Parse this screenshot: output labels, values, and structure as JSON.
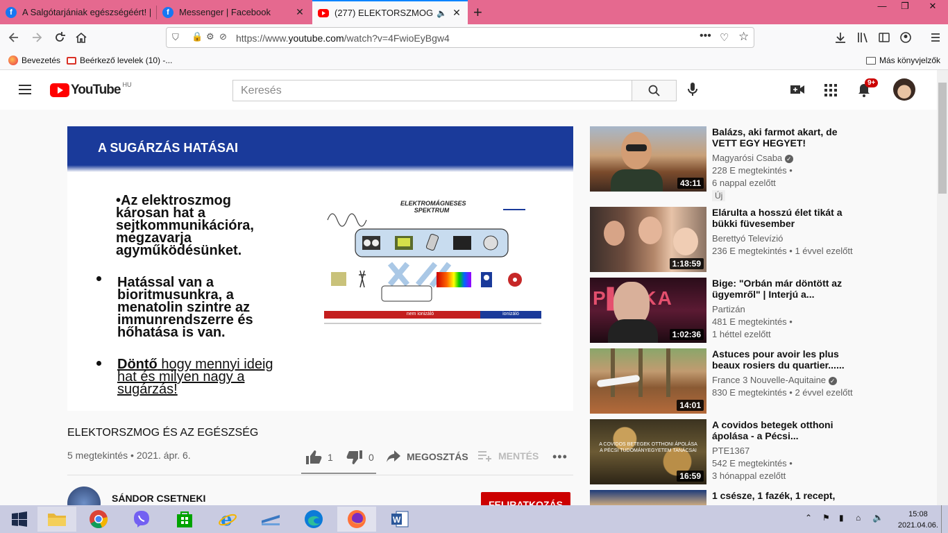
{
  "browser": {
    "tabs": [
      {
        "label": "A Salgótarjániak egészségéért! |",
        "active": false
      },
      {
        "label": "Messenger | Facebook",
        "active": false
      },
      {
        "label": "(277) ELEKTORSZMOG ÉS A",
        "active": true
      }
    ],
    "new_tab": "+",
    "url_prefix": "https://www.",
    "url_domain": "youtube.com",
    "url_rest": "/watch?v=4FwioEyBgw4",
    "bookmarks": [
      {
        "label": "Bevezetés"
      },
      {
        "label": "Beérkező levelek (10) -..."
      }
    ],
    "other_bookmarks": "Más könyvjelzők"
  },
  "youtube": {
    "logo_text": "YouTube",
    "country": "HU",
    "search_placeholder": "Keresés",
    "notifications": "9+",
    "slide": {
      "title": "A SUGÁRZÁS HATÁSAI",
      "bullet1": "•Az elektroszmog károsan hat a sejtkommunikációra, megzavarja agyműködésünket.",
      "bullet2": "Hatással van a bioritmusunkra, a menatolin szintre az immunrendszerre és hőhatása is van.",
      "bullet3_bold": "Döntő",
      "bullet3_rest": " hogy mennyi ideig hat és milyen nagy a sugárzás!",
      "spectrum_title": "ELEKTROMÁGNESES SPEKTRUM",
      "nonionizing": "nem ionizáló",
      "ionizing": "ionizáló"
    },
    "video": {
      "title": "ELEKTORSZMOG ÉS AZ EGÉSZSÉG",
      "meta": "5 megtekintés • 2021. ápr. 6.",
      "likes": "1",
      "dislikes": "0",
      "share": "MEGOSZTÁS",
      "save": "MENTÉS",
      "channel": "SÁNDOR CSETNEKI",
      "subscribe": "FELIRATKOZÁS"
    },
    "recommendations": [
      {
        "title": "Balázs, aki farmot akart, de VETT EGY HEGYET!",
        "channel": "Magyarósi Csaba",
        "views": "228 E megtekintés •",
        "age": "6 nappal ezelőtt",
        "badge": "Új",
        "duration": "43:11",
        "verified": true
      },
      {
        "title": "Elárulta a hosszú élet tikát a bükki füvesember",
        "channel": "Berettyó Televízió",
        "views": "236 E megtekintés • 1 évvel ezelőtt",
        "age": "",
        "badge": "",
        "duration": "1:18:59",
        "verified": false
      },
      {
        "title": "Bige: \"Orbán már döntött az ügyemről\" | Interjú a...",
        "channel": "Partizán",
        "views": "481 E megtekintés •",
        "age": "1 héttel ezelőtt",
        "badge": "",
        "duration": "1:02:36",
        "verified": false
      },
      {
        "title": "Astuces pour avoir les plus beaux rosiers du quartier......",
        "channel": "France 3 Nouvelle-Aquitaine",
        "views": "830 E megtekintés • 2 évvel ezelőtt",
        "age": "",
        "badge": "",
        "duration": "14:01",
        "verified": true
      },
      {
        "title": "A covidos betegek otthoni ápolása - a Pécsi...",
        "channel": "PTE1367",
        "views": "542 E megtekintés •",
        "age": "3 hónappal ezelőtt",
        "badge": "",
        "duration": "16:59",
        "verified": false
      },
      {
        "title": "1 csésze, 1 fazék, 1 recept,",
        "channel": "",
        "views": "",
        "age": "",
        "badge": "",
        "duration": "",
        "verified": false
      }
    ]
  },
  "taskbar": {
    "time": "15:08",
    "date": "2021.04.06."
  },
  "colors": {
    "tabbar": "#e5698f",
    "yt_red": "#ff0000",
    "slide_blue": "#1a3a9a",
    "taskbar": "#c9cbe1"
  }
}
